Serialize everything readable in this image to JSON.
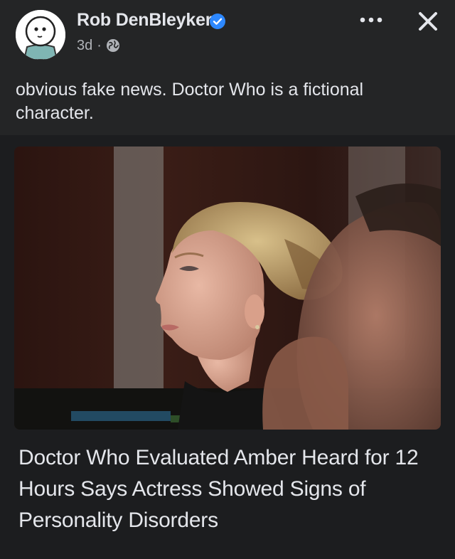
{
  "post": {
    "author_name": "Rob DenBleyker",
    "verified": true,
    "time_ago": "3d",
    "separator": "·",
    "audience_icon": "globe-icon",
    "text": "obvious fake news. Doctor Who is a fictional character."
  },
  "actions": {
    "more_icon": "more-options-icon",
    "close_icon": "close-icon"
  },
  "link_card": {
    "image_subject": "photo-courtroom",
    "headline": "Doctor Who Evaluated Amber Heard for 12 Hours Says Actress Showed Signs of Personality Disorders"
  },
  "colors": {
    "background": "#242526",
    "card_background": "#1c1d1f",
    "primary_text": "#e4e6eb",
    "secondary_text": "#b0b3b8",
    "verified_blue": "#2d88ff"
  }
}
